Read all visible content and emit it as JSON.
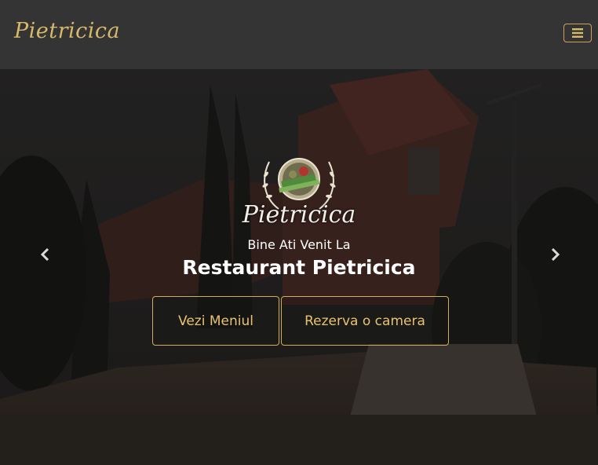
{
  "navbar": {
    "brand": "Pietricica",
    "toggler_icon": "hamburger-icon"
  },
  "hero": {
    "logo_text": "Pietricica",
    "welcome": "Bine Ati Venit La",
    "title": "Restaurant Pietricica",
    "buttons": {
      "menu": "Vezi Meniul",
      "book": "Rezerva o camera"
    },
    "prev_icon": "chevron-left-icon",
    "next_icon": "chevron-right-icon"
  },
  "colors": {
    "navbar_bg": "#343434",
    "accent_gold": "#d3ad5a",
    "hero_text": "#ffffff"
  }
}
